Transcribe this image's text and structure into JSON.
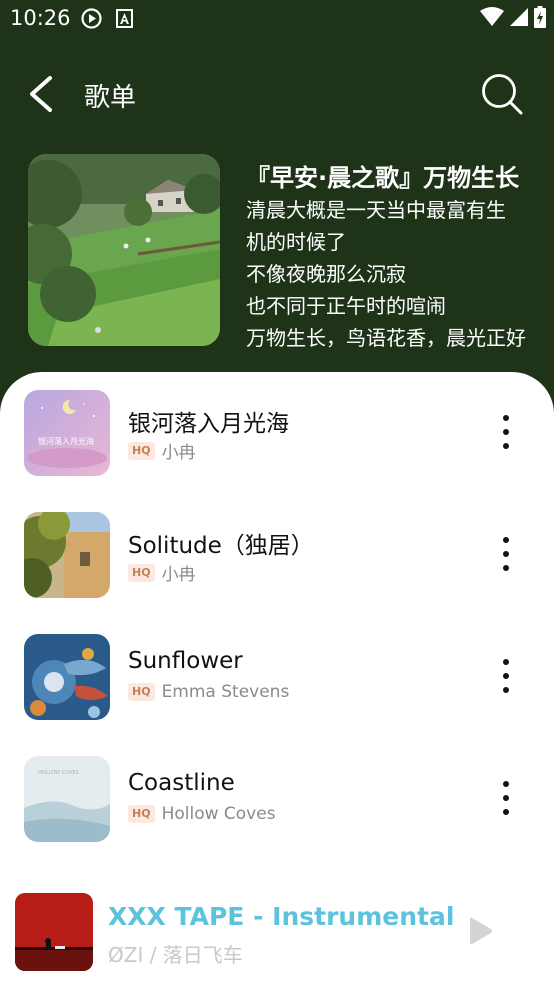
{
  "status_bar": {
    "time": "10:26",
    "icons": [
      "play-circle-icon",
      "notification-a-icon",
      "wifi-icon",
      "signal-icon",
      "battery-charging-icon"
    ]
  },
  "header": {
    "title": "歌单",
    "back_icon": "chevron-left-icon",
    "search_icon": "search-icon"
  },
  "playlist": {
    "title": "『早安·晨之歌』万物生长",
    "description_lines": [
      "清晨大概是一天当中最富有生",
      "机的时候了",
      "不像夜晚那么沉寂",
      "也不同于正午时的喧闹",
      "万物生长，鸟语花香，晨光正好"
    ]
  },
  "songs": [
    {
      "title": "银河落入月光海",
      "badge": "HQ",
      "artist": "小冉",
      "cover_text": "银河落入月光海"
    },
    {
      "title": "Solitude（独居）",
      "badge": "HQ",
      "artist": "小冉"
    },
    {
      "title": "Sunflower",
      "badge": "HQ",
      "artist": "Emma Stevens"
    },
    {
      "title": "Coastline",
      "badge": "HQ",
      "artist": "Hollow Coves",
      "cover_text": "HOLLOW COVES"
    }
  ],
  "now_playing": {
    "title": "XXX TAPE - Instrumental",
    "subtitle": "ØZI / 落日飞车",
    "title_color": "#5cc3de",
    "play_icon": "play-icon"
  },
  "colors": {
    "header_bg": "#1f3319",
    "badge_text": "#c4805a",
    "badge_bg": "#fbe8df"
  }
}
